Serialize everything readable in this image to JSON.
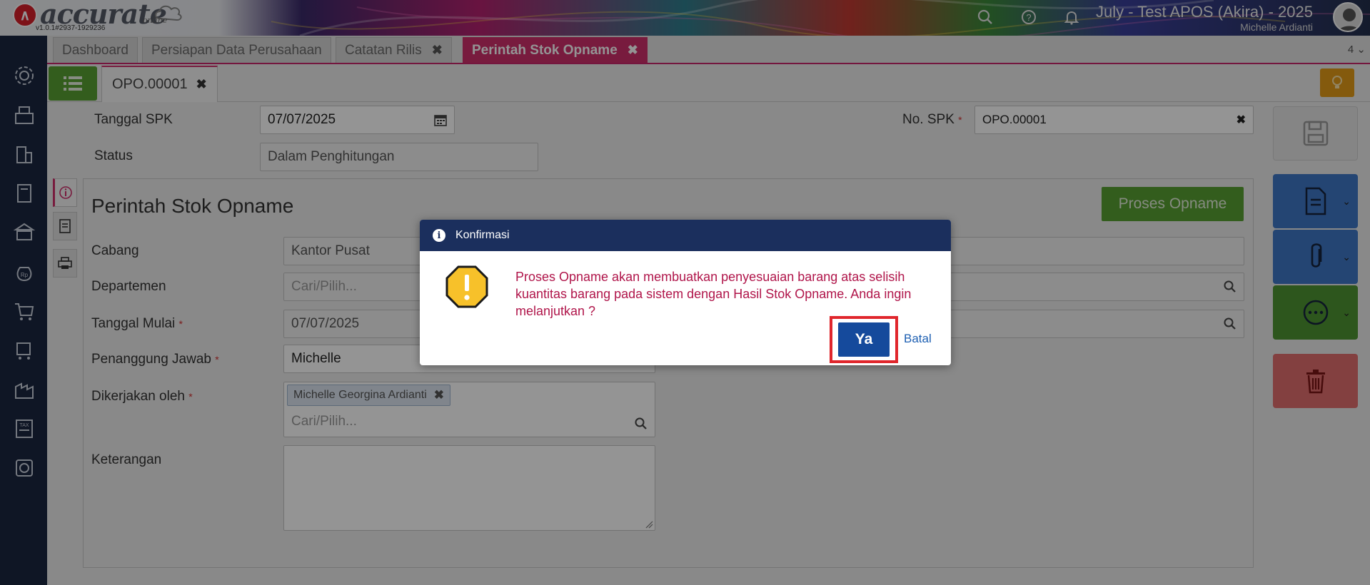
{
  "header": {
    "logo_text": "accurate",
    "logo_sub": "online",
    "version": "v1.0.1#2937-1929236",
    "company_name": "July - Test APOS (Akira) - 2025",
    "user_name": "Michelle Ardianti"
  },
  "tabs": {
    "items": [
      {
        "label": "Dashboard"
      },
      {
        "label": "Persiapan Data Perusahaan"
      },
      {
        "label": "Catatan Rilis"
      },
      {
        "label": "Perintah Stok Opname"
      }
    ],
    "count": "4"
  },
  "subtab": {
    "label": "OPO.00001"
  },
  "form": {
    "tanggal_spk_label": "Tanggal SPK",
    "tanggal_spk_value": "07/07/2025",
    "status_label": "Status",
    "status_value": "Dalam Penghitungan",
    "no_spk_label": "No. SPK",
    "no_spk_value": "OPO.00001",
    "required_mark": "*"
  },
  "panel": {
    "title": "Perintah Stok Opname",
    "proses_button": "Proses Opname",
    "cabang_label": "Cabang",
    "cabang_value": "Kantor Pusat",
    "departemen_label": "Departemen",
    "departemen_placeholder": "Cari/Pilih...",
    "tanggal_mulai_label": "Tanggal Mulai",
    "tanggal_mulai_value": "07/07/2025",
    "penanggung_label": "Penanggung Jawab",
    "penanggung_value": "Michelle",
    "dikerjakan_label": "Dikerjakan oleh",
    "dikerjakan_chip": "Michelle Georgina Ardianti",
    "dikerjakan_placeholder": "Cari/Pilih...",
    "keterangan_label": "Keterangan"
  },
  "dialog": {
    "title": "Konfirmasi",
    "message": "Proses Opname akan membuatkan penyesuaian barang atas selisih kuantitas barang pada sistem dengan Hasil Stok Opname. Anda ingin melanjutkan ?",
    "yes_label": "Ya",
    "cancel_label": "Batal"
  },
  "colors": {
    "accent": "#cf2f6c",
    "green": "#58a032",
    "navy": "#1b2f5d",
    "primary_button": "#154a9c",
    "highlight": "#e0262c",
    "message_text": "#b0154a"
  }
}
